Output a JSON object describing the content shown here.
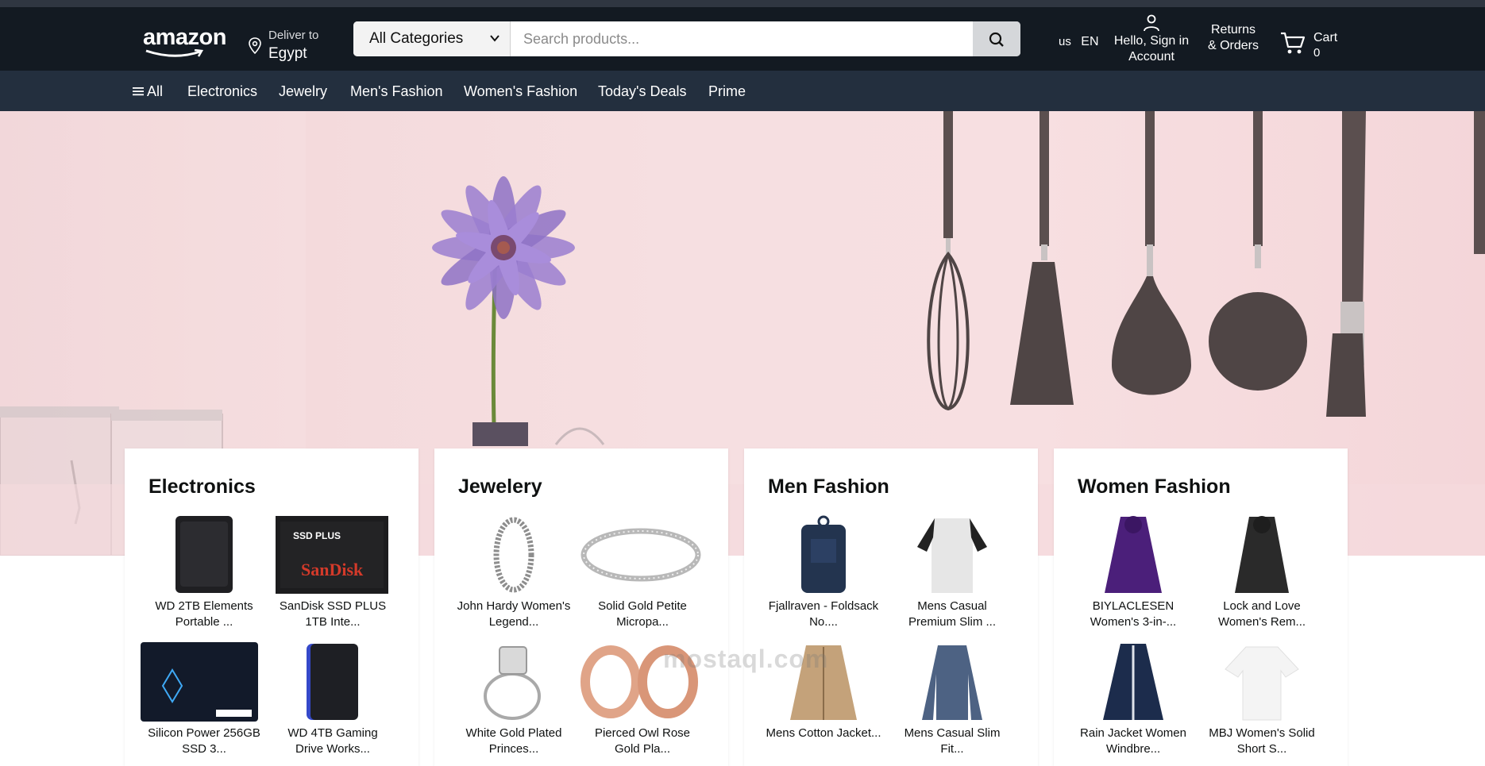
{
  "header": {
    "logo": "amazon",
    "deliver_label": "Deliver to",
    "deliver_location": "Egypt",
    "category_selected": "All Categories",
    "search_placeholder": "Search products...",
    "lang_flag": "us",
    "lang_code": "EN",
    "account_line1": "Hello, Sign in",
    "account_line2": "Account",
    "returns_line1": "Returns",
    "returns_line2": "& Orders",
    "cart_label": "Cart",
    "cart_count": "0",
    "icons": {
      "pin": "location-pin-icon",
      "search": "search-icon",
      "person": "person-icon",
      "cart": "cart-icon",
      "menu": "hamburger-icon"
    }
  },
  "nav": {
    "items": [
      "All",
      "Electronics",
      "Jewelry",
      "Men's Fashion",
      "Women's Fashion",
      "Today's Deals",
      "Prime"
    ]
  },
  "cards": [
    {
      "title": "Electronics",
      "products": [
        {
          "cap1": "WD 2TB Elements",
          "cap2": "Portable ..."
        },
        {
          "cap1": "SanDisk SSD PLUS",
          "cap2": "1TB Inte..."
        },
        {
          "cap1": "Silicon Power 256GB",
          "cap2": "SSD 3..."
        },
        {
          "cap1": "WD 4TB Gaming",
          "cap2": "Drive Works..."
        }
      ]
    },
    {
      "title": "Jewelery",
      "products": [
        {
          "cap1": "John Hardy Women's",
          "cap2": "Legend..."
        },
        {
          "cap1": "Solid Gold Petite",
          "cap2": "Micropa..."
        },
        {
          "cap1": "White Gold Plated",
          "cap2": "Princes..."
        },
        {
          "cap1": "Pierced Owl Rose",
          "cap2": "Gold Pla..."
        }
      ]
    },
    {
      "title": "Men Fashion",
      "products": [
        {
          "cap1": "Fjallraven - Foldsack",
          "cap2": "No...."
        },
        {
          "cap1": "Mens Casual",
          "cap2": "Premium Slim ..."
        },
        {
          "cap1": "Mens Cotton Jacket...",
          "cap2": ""
        },
        {
          "cap1": "Mens Casual Slim",
          "cap2": "Fit..."
        }
      ]
    },
    {
      "title": "Women Fashion",
      "products": [
        {
          "cap1": "BIYLACLESEN",
          "cap2": "Women's 3-in-..."
        },
        {
          "cap1": "Lock and Love",
          "cap2": "Women's Rem..."
        },
        {
          "cap1": "Rain Jacket Women",
          "cap2": "Windbre..."
        },
        {
          "cap1": "MBJ Women's Solid",
          "cap2": "Short S..."
        }
      ]
    }
  ],
  "watermark": "mostaql.com",
  "colors": {
    "header_bg": "#131a22",
    "nav_bg": "#232f3e",
    "hero_bg": "#f6dfe1"
  }
}
